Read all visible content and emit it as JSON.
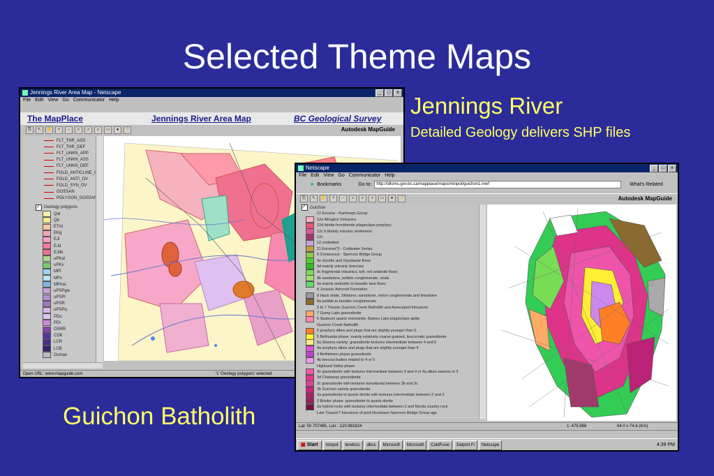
{
  "slide": {
    "title": "Selected Theme Maps",
    "jennings_title": "Jennings River",
    "jennings_subtitle": "Detailed Geology delivers SHP files",
    "guichon_caption": "Guichon Batholith"
  },
  "window1": {
    "title": "Jennings River Area Map - Netscape",
    "menu": [
      "File",
      "Edit",
      "View",
      "Go",
      "Communicator",
      "Help"
    ],
    "banner_left": "The MapPlace",
    "banner_center": "Jennings River Area Map",
    "banner_right": "BC Geological Survey",
    "toolbar_brand": "Autodesk MapGuide",
    "legend_lines": [
      "FLT_THR_ASS",
      "FLT_THR_DEF",
      "FLT_UNKN_APP",
      "FLT_UNKN_ASS",
      "FLT_UNKN_DEF",
      "FOLD_ANTICLINE_U",
      "FOLD_ANTI_OV",
      "FOLD_SYN_OV",
      "GOSSAN",
      "POLYGON_GOSSAN"
    ],
    "legend_group": "Geology polygons",
    "legend_polys": [
      {
        "label": "Qal",
        "color": "#f4f0a8"
      },
      {
        "label": "Qb",
        "color": "#f2e98a"
      },
      {
        "label": "ETrd",
        "color": "#f7c9a0"
      },
      {
        "label": "EKg",
        "color": "#f4a8b8"
      },
      {
        "label": "EJi",
        "color": "#ff9ec8"
      },
      {
        "label": "EJd",
        "color": "#f77aa0"
      },
      {
        "label": "EJdk",
        "color": "#ee6f8c"
      },
      {
        "label": "uPKal",
        "color": "#a8d88c"
      },
      {
        "label": "uPKv",
        "color": "#7cc870"
      },
      {
        "label": "MPl",
        "color": "#9fd0f0"
      },
      {
        "label": "MPv",
        "color": "#b9e3f2"
      },
      {
        "label": "MPma",
        "color": "#7fb6e6"
      },
      {
        "label": "uPSPgw",
        "color": "#c79fd9"
      },
      {
        "label": "uPSPl",
        "color": "#b48fd0"
      },
      {
        "label": "uPSR",
        "color": "#9a78c0"
      },
      {
        "label": "uPSPq",
        "color": "#d7b7e6"
      },
      {
        "label": "PDu",
        "color": "#e0c4f0"
      },
      {
        "label": "PDl",
        "color": "#cc88dd"
      },
      {
        "label": "OSRR",
        "color": "#8844aa"
      },
      {
        "label": "CDK",
        "color": "#5533aa"
      },
      {
        "label": "LCR",
        "color": "#4a2a8a"
      },
      {
        "label": "LCB",
        "color": "#3a2070"
      },
      {
        "label": "Ocman",
        "color": "#b8b8c8"
      }
    ],
    "status_left": "Open URL: www.mapguide.com",
    "status_right": "'1 'Geology polygons' selected"
  },
  "window2": {
    "title": "Netscape",
    "menu": [
      "File",
      "Edit",
      "View",
      "Go",
      "Communicator",
      "Help"
    ],
    "bookmarks_label": "Bookmarks",
    "goto_label": "Go to:",
    "url": "http://idloms.gov.bc.ca/mapplace/maps/minpot/guichon1.mwf",
    "whats_related": "What's Related",
    "toolbar_brand": "Autodesk MapGuide",
    "legend_group": "Guichon",
    "legend_items": [
      {
        "label": "12 Eocene - Kamloops Group",
        "color": ""
      },
      {
        "label": "12e Allington Volcanics",
        "color": "#ffb0c0"
      },
      {
        "label": "12d biotite-hornblende plagioclase porphyry",
        "color": "#ee5577"
      },
      {
        "label": "12c b.Mainly volcanic sediments",
        "color": "#d65a9a"
      },
      {
        "label": "12c",
        "color": "#a03a6a"
      },
      {
        "label": "12 undivided",
        "color": "#c7a0d8"
      },
      {
        "label": "11 Eocene(?) - Coldwater Series",
        "color": "#bfa040"
      },
      {
        "label": "9 Cretaceous - Spences Bridge Group",
        "color": "#96c84a"
      },
      {
        "label": "9e rhyolite and rhyodacite flows",
        "color": "#55cc33"
      },
      {
        "label": "9d mainly volcanic breccias",
        "color": "#33bb22"
      },
      {
        "label": "9c fragmental volcanics, tuff, red andesite flows",
        "color": "#77dd55"
      },
      {
        "label": "9b sandstone, pebble conglomerate, shale",
        "color": "#a0e070"
      },
      {
        "label": "9a mainly andesitic to basaltic lava flows",
        "color": "#66dd66"
      },
      {
        "label": "8 Jurassic Ashcroft Formation",
        "color": ""
      },
      {
        "label": "8 black shale, Siltstone, sandstone, minor conglomerate and limestone",
        "color": "#999999"
      },
      {
        "label": "8a pebble to boulder conglomerate",
        "color": "#8a6a30"
      },
      {
        "label": "2 to 7 Triassic Guichon Creek Batholith and Associated Intrusions",
        "color": ""
      },
      {
        "label": "7 Gump Lake granodiorite",
        "color": "#ffaa66"
      },
      {
        "label": "6 Spatsum quartz monzonite, Bames Lake plagioclase aplite",
        "color": "#ff88aa"
      },
      {
        "label": "Guichon Creek Batholith",
        "color": ""
      },
      {
        "label": "5 porphyry dikes and plugs that are slightly younger than 5",
        "color": "#ff7f27"
      },
      {
        "label": "5 Bethsaida phase: mainly relatively coarse grained, leucocratic granodiorite",
        "color": "#ffee33"
      },
      {
        "label": "5a Skeena variety: granodiorite textures intermediate between 4 and 5",
        "color": "#f6f080"
      },
      {
        "label": "4a porphyry dikes and plugs that are slightly younger than 4",
        "color": "#dd55dd"
      },
      {
        "label": "4 Bethlehem phase granodiorite",
        "color": "#bb44cc"
      },
      {
        "label": "4b breccia bodies related to 4 or 5",
        "color": "#ee99ee"
      },
      {
        "label": "Highland Valley phase",
        "color": ""
      },
      {
        "label": "3e granodiorite with textures intermediate between 3 and 4 or 4a dikes swarms in 3",
        "color": "#ff55aa"
      },
      {
        "label": "3d Chataway granodiorite",
        "color": "#ee3388"
      },
      {
        "label": "3c granodiorite with textures transitional between 3b and 3c",
        "color": "#dd4499"
      },
      {
        "label": "3b Guichon variety granodiorite",
        "color": "#cc2277"
      },
      {
        "label": "3a granodiorite to quartz diorite with textures intermediate between 2 and 3",
        "color": "#aa2266"
      },
      {
        "label": "2 Border phase: granodiorite to quartz diorite",
        "color": "#992255"
      },
      {
        "label": "2a hybrid rocks with textures intermediate between 2 and Nicola country rock",
        "color": "#771144"
      },
      {
        "label": "Late Triassic? Intrusions of post-Nicola/pre-Spences Bridge Group age",
        "color": ""
      }
    ],
    "status_coords": "Lat: 50.707485, Lon: -120.981624",
    "status_scale": "1: 475,988",
    "status_extent": "64.0 x 74.6 (Km)",
    "taskbar_start": "Start",
    "taskbar_items": [
      "minpot",
      "tendocs",
      "dbos",
      "Microsoft",
      "Microsoft",
      "ColdFusio",
      "Delpmt Fi",
      "Netscape"
    ],
    "taskbar_time": "4:39 PM"
  }
}
